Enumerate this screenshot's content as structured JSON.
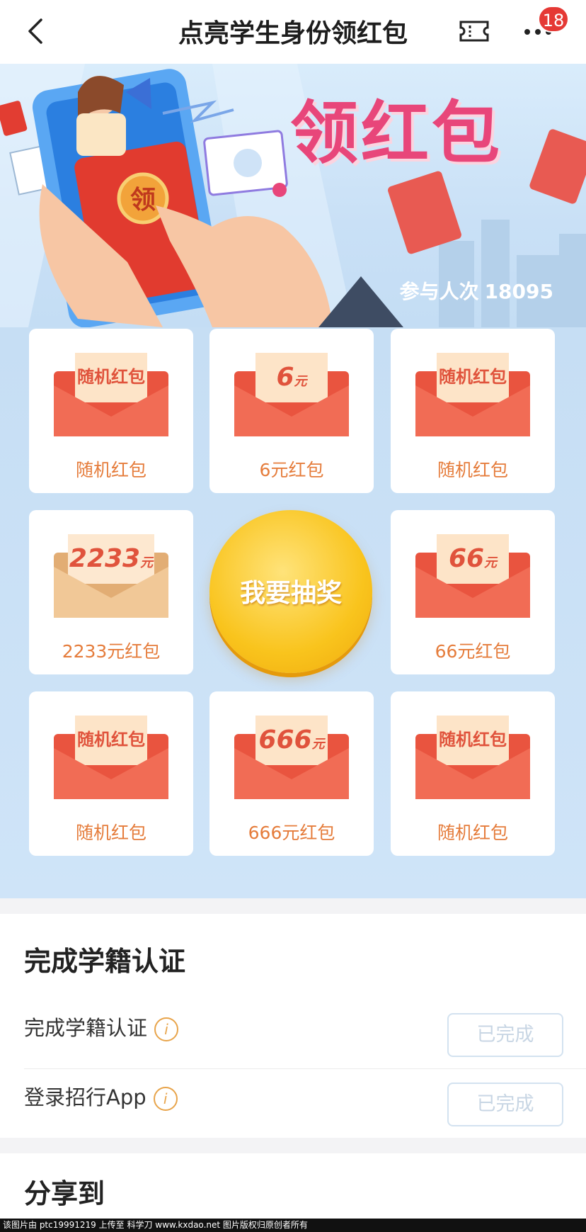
{
  "header": {
    "title": "点亮学生身份领红包",
    "badge_count": "18"
  },
  "banner": {
    "headline": "领红包",
    "coin_char": "领",
    "participants_label": "参与人次",
    "participants_count": "18095"
  },
  "grid": {
    "cards": [
      {
        "envelope_text": "随机红包",
        "label": "随机红包"
      },
      {
        "envelope_text": "6",
        "envelope_unit": "元",
        "label": "6元红包"
      },
      {
        "envelope_text": "随机红包",
        "label": "随机红包"
      },
      {
        "envelope_text": "2233",
        "envelope_unit": "元",
        "label": "2233元红包"
      },
      {
        "envelope_text": "66",
        "envelope_unit": "元",
        "label": "66元红包"
      },
      {
        "envelope_text": "随机红包",
        "label": "随机红包"
      },
      {
        "envelope_text": "666",
        "envelope_unit": "元",
        "label": "666元红包"
      },
      {
        "envelope_text": "随机红包",
        "label": "随机红包"
      }
    ],
    "draw_button": "我要抽奖"
  },
  "certification": {
    "title": "完成学籍认证",
    "tasks": [
      {
        "label": "完成学籍认证",
        "status": "已完成"
      },
      {
        "label": "登录招行App",
        "status": "已完成"
      }
    ],
    "info_glyph": "i"
  },
  "share": {
    "title": "分享到"
  },
  "watermark": "该图片由 ptc19991219 上传至 科学刀 www.kxdao.net 图片版权归原创者所有",
  "colors": {
    "accent_red": "#e53935",
    "label_orange": "#e57c3b",
    "draw_gold": "#f9c41d",
    "banner_blue": "#d9ecfb"
  }
}
